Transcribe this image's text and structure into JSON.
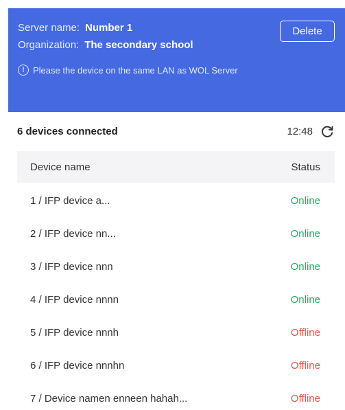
{
  "header": {
    "server_label": "Server name:",
    "server_value": "Number 1",
    "org_label": "Organization:",
    "org_value": "The secondary school",
    "delete_label": "Delete",
    "notice_icon": "!",
    "notice_text": "Please the device on the same LAN as WOL Server",
    "accent_color": "#4569e0"
  },
  "summary": {
    "count_text": "6 devices connected",
    "time": "12:48",
    "refresh_icon": "refresh-icon"
  },
  "table": {
    "col_name": "Device name",
    "col_status": "Status",
    "status_colors": {
      "online": "#13b35c",
      "offline": "#ef5346"
    },
    "rows": [
      {
        "name": "1 / IFP device a...",
        "status": "Online",
        "state": "online"
      },
      {
        "name": "2 / IFP device nn...",
        "status": "Online",
        "state": "online"
      },
      {
        "name": "3 / IFP device nnn",
        "status": "Online",
        "state": "online"
      },
      {
        "name": "4 / IFP device nnnn",
        "status": "Online",
        "state": "online"
      },
      {
        "name": "5 / IFP device nnnh",
        "status": "Offline",
        "state": "offline"
      },
      {
        "name": "6 / IFP device nnnhn",
        "status": "Offline",
        "state": "offline"
      },
      {
        "name": "7 / Device namen enneen hahah...",
        "status": "Offline",
        "state": "offline"
      }
    ]
  }
}
